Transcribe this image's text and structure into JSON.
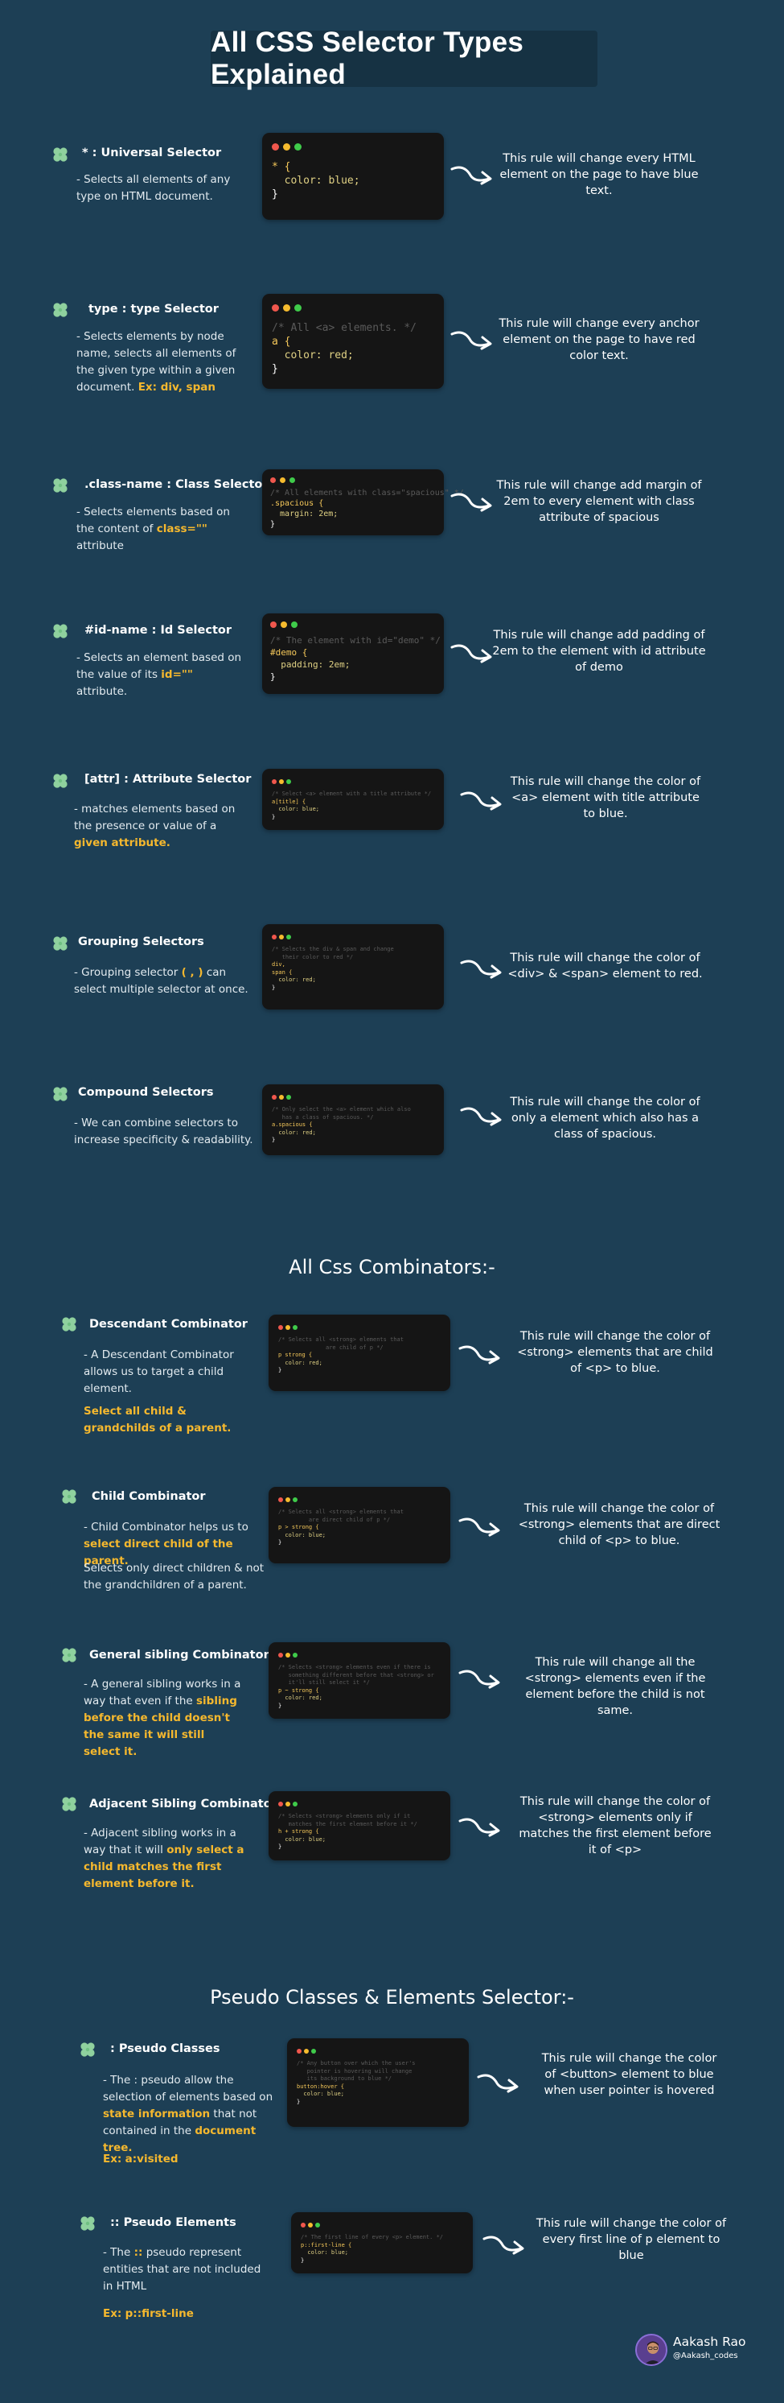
{
  "page": {
    "title": "All CSS Selector Types Explained"
  },
  "colors": {
    "background": "#1d3f55",
    "highlight": "#f5b82e",
    "code_bg": "#151515"
  },
  "sections": {
    "universal": {
      "head": "* : Universal Selector",
      "desc": "- Selects all elements of any type on HTML document.",
      "code": [
        "* {",
        "  color: blue;",
        "}"
      ],
      "result": "This rule will change every HTML element on the page to have blue text."
    },
    "type": {
      "head": "type : type Selector",
      "desc": "- Selects elements by node name, selects all elements of the given type within a given document.",
      "desc_hl": "Ex: div, span",
      "code": [
        "/* All <a> elements. */",
        "a {",
        "  color: red;",
        "}"
      ],
      "result": "This rule will change every anchor element on the page to have red color text."
    },
    "class": {
      "head": ".class-name : Class Selector",
      "desc_a": "- Selects elements based on the content of",
      "desc_hl": "class=\"\"",
      "desc_b": "attribute",
      "code": [
        "/* All elements with class=\"spacious\" */",
        ".spacious {",
        "  margin: 2em;",
        "}"
      ],
      "result": "This rule will change add margin of 2em to every element with class attribute of spacious"
    },
    "id": {
      "head": "#id-name : Id Selector",
      "desc_a": "- Selects an element based on the value of its",
      "desc_hl": "id=\"\"",
      "desc_b": "attribute.",
      "code": [
        "/* The element with id=\"demo\" */",
        "#demo {",
        "  padding: 2em;",
        "}"
      ],
      "result": "This rule will change add padding of 2em to the element with id attribute of demo"
    },
    "attr": {
      "head": "[attr] : Attribute Selector",
      "desc_a": "- matches elements based on the presence or value of a",
      "desc_hl": "given attribute.",
      "code": [
        "/* Select <a> element with a title attribute */",
        "a[title] {",
        "  color: blue;",
        "}"
      ],
      "result": "This rule will change the color of <a> element with title attribute to blue."
    },
    "grouping": {
      "head": "Grouping Selectors",
      "desc_a": "- Grouping selector",
      "desc_hl": "( , )",
      "desc_b": "can select multiple selector at once.",
      "code": [
        "/* Selects the div & span and change",
        "   their color to red */",
        "div,",
        "span {",
        "  color: red;",
        "}"
      ],
      "result": "This rule will change the color of <div> & <span> element to red."
    },
    "compound": {
      "head": "Compound Selectors",
      "desc": "- We can combine selectors to increase specificity & readability.",
      "code": [
        "/* Only select the <a> element which also",
        "   has a class of spacious. */",
        "a.spacious {",
        "  color: red;",
        "}"
      ],
      "result": "This rule will change the color of only a element which also has a class of spacious."
    },
    "combinators_title": "All Css Combinators:-",
    "descendant": {
      "head": "Descendant Combinator",
      "desc": "- A Descendant Combinator allows us to target a child element.",
      "desc_hl": "Select all child & grandchilds of a parent.",
      "code": [
        "/* Selects all <strong> elements that",
        "              are child of p */",
        "p strong {",
        "  color: red;",
        "}"
      ],
      "result": "This rule will change the color of <strong> elements that are child of <p> to blue."
    },
    "child": {
      "head": "Child Combinator",
      "desc_a": "- Child Combinator helps us to",
      "desc_hl": "select direct child of the parent.",
      "desc_b": "Selects only direct children & not the grandchildren of a parent.",
      "code": [
        "/* Selects all <strong> elements that",
        "         are direct child of p */",
        "p > strong {",
        "  color: blue;",
        "}"
      ],
      "result": "This rule will change the color of <strong> elements that are direct child of <p> to blue."
    },
    "general": {
      "head": "General sibling Combinator",
      "desc_a": "- A general sibling works in a way that even if the",
      "desc_hl": "sibling before the child doesn't the same it will still select it.",
      "code": [
        "/* Selects <strong> elements even if there is",
        "   something different before that <strong> or",
        "   it'll still select it */",
        "p ~ strong {",
        "  color: red;",
        "}"
      ],
      "result": "This rule will change all the <strong> elements even if the element before the child is not same."
    },
    "adjacent": {
      "head": "Adjacent Sibling Combinator",
      "desc_a": "- Adjacent sibling works in a way that it will",
      "desc_hl": "only select a child matches the first element before it.",
      "code": [
        "/* Selects <strong> elements only if it",
        "   matches the first element before it */",
        "h + strong {",
        "  color: blue;",
        "}"
      ],
      "result": "This rule will change the color of <strong> elements only if matches the first element before it of <p>"
    },
    "pseudo_title": "Pseudo Classes & Elements Selector:-",
    "pseudo_class": {
      "head": ": Pseudo Classes",
      "desc_a": "- The : pseudo allow the selection of elements based on",
      "desc_hl": "state information",
      "desc_b": "that not contained in the",
      "desc_hl2": "document tree.",
      "ex_label": "Ex:",
      "ex_val": "a:visited",
      "code": [
        "/* Any button over which the user's",
        "   pointer is hovering will change",
        "   its background to blue */",
        "button:hover {",
        "  color: blue;",
        "}"
      ],
      "result": "This rule will change the color of <button> element to blue when user pointer is hovered"
    },
    "pseudo_element": {
      "head": ":: Pseudo Elements",
      "desc_a": "- The",
      "desc_hl": "::",
      "desc_b": "pseudo represent entities that are not included in HTML",
      "ex_label": "Ex:",
      "ex_val": "p::first-line",
      "code": [
        "/* The first line of every <p> element. */",
        "p::first-line {",
        "  color: blue;",
        "}"
      ],
      "result": "This rule will change the color of every first line of p element to blue"
    }
  },
  "author": {
    "name": "Aakash Rao",
    "handle": "@Aakash_codes"
  },
  "icons": {
    "bullet": "clover-icon",
    "arrow": "curved-arrow-icon"
  }
}
